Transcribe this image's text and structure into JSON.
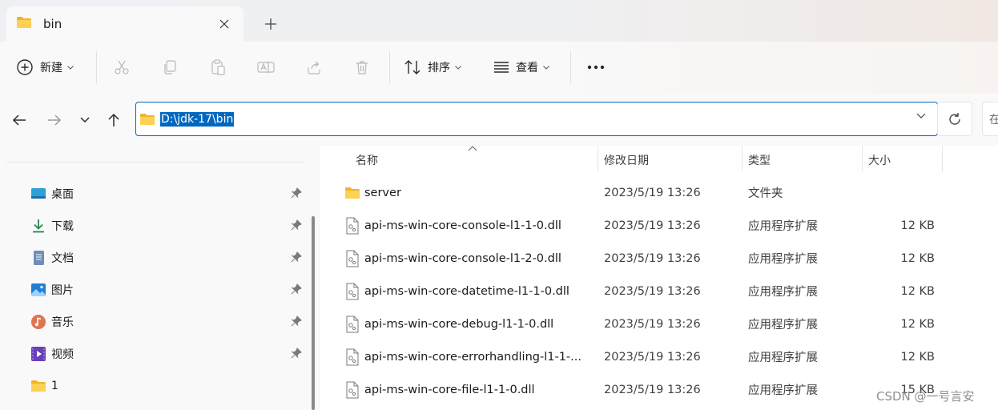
{
  "tab": {
    "title": "bin"
  },
  "toolbar": {
    "new_label": "新建",
    "sort_label": "排序",
    "view_label": "查看"
  },
  "address": {
    "path": "D:\\jdk-17\\bin",
    "search_stub": "在"
  },
  "sidebar": {
    "items": [
      {
        "label": "桌面",
        "icon": "desktop-icon",
        "pinned": true
      },
      {
        "label": "下载",
        "icon": "download-icon",
        "pinned": true
      },
      {
        "label": "文档",
        "icon": "documents-icon",
        "pinned": true
      },
      {
        "label": "图片",
        "icon": "pictures-icon",
        "pinned": true
      },
      {
        "label": "音乐",
        "icon": "music-icon",
        "pinned": true
      },
      {
        "label": "视频",
        "icon": "videos-icon",
        "pinned": true
      },
      {
        "label": "1",
        "icon": "folder-icon",
        "pinned": false
      }
    ]
  },
  "columns": {
    "name": "名称",
    "modified": "修改日期",
    "type": "类型",
    "size": "大小"
  },
  "files": [
    {
      "name": "server",
      "icon": "folder-icon",
      "modified": "2023/5/19 13:26",
      "type": "文件夹",
      "size": ""
    },
    {
      "name": "api-ms-win-core-console-l1-1-0.dll",
      "icon": "dll-file-icon",
      "modified": "2023/5/19 13:26",
      "type": "应用程序扩展",
      "size": "12 KB"
    },
    {
      "name": "api-ms-win-core-console-l1-2-0.dll",
      "icon": "dll-file-icon",
      "modified": "2023/5/19 13:26",
      "type": "应用程序扩展",
      "size": "12 KB"
    },
    {
      "name": "api-ms-win-core-datetime-l1-1-0.dll",
      "icon": "dll-file-icon",
      "modified": "2023/5/19 13:26",
      "type": "应用程序扩展",
      "size": "12 KB"
    },
    {
      "name": "api-ms-win-core-debug-l1-1-0.dll",
      "icon": "dll-file-icon",
      "modified": "2023/5/19 13:26",
      "type": "应用程序扩展",
      "size": "12 KB"
    },
    {
      "name": "api-ms-win-core-errorhandling-l1-1-...",
      "icon": "dll-file-icon",
      "modified": "2023/5/19 13:26",
      "type": "应用程序扩展",
      "size": "12 KB"
    },
    {
      "name": "api-ms-win-core-file-l1-1-0.dll",
      "icon": "dll-file-icon",
      "modified": "2023/5/19 13:26",
      "type": "应用程序扩展",
      "size": "15 KB"
    }
  ],
  "watermark": "CSDN @一号言安",
  "colors": {
    "accent": "#0067c0",
    "folder": "#f5c542"
  }
}
